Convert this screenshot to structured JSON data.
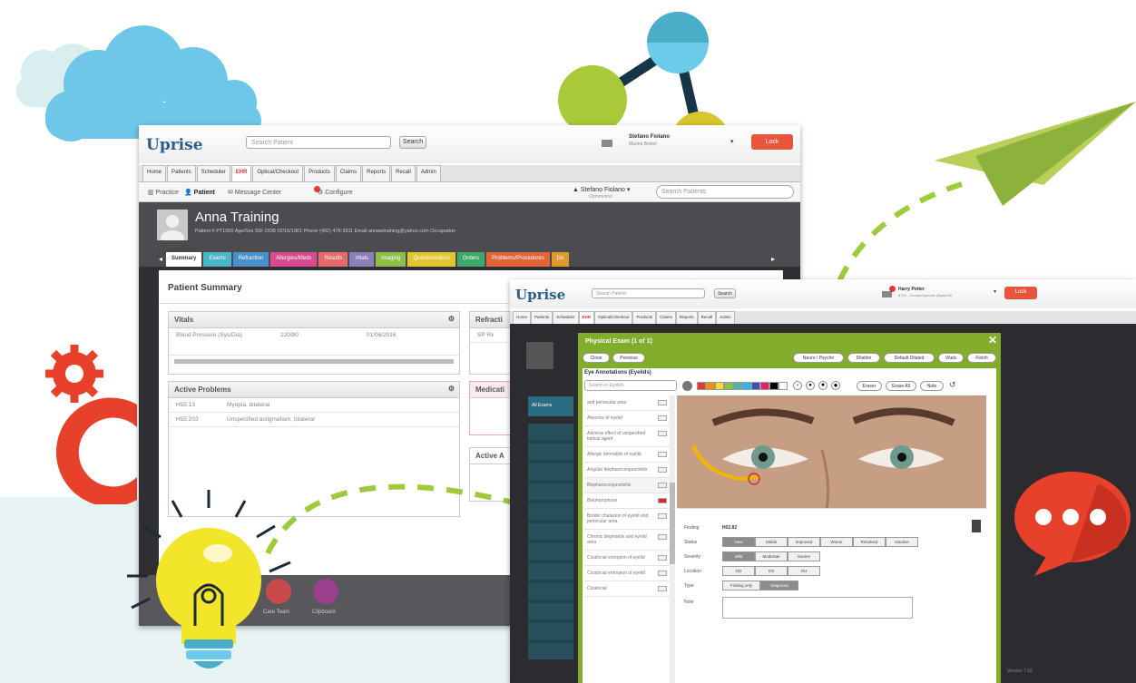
{
  "back_window": {
    "logo": "Uprise",
    "search_placeholder": "Search Patient",
    "search_button": "Search",
    "user_name": "Stefano Fiolano",
    "user_sub": "Marina Bristol",
    "lock_button": "Lock",
    "tabs": [
      {
        "label": "Home",
        "active": false
      },
      {
        "label": "Patients",
        "active": false
      },
      {
        "label": "Scheduler",
        "active": false
      },
      {
        "label": "EHR",
        "active": true
      },
      {
        "label": "Optical/Checkout",
        "active": false
      },
      {
        "label": "Products",
        "active": false
      },
      {
        "label": "Claims",
        "active": false
      },
      {
        "label": "Reports",
        "active": false
      },
      {
        "label": "Recall",
        "active": false
      },
      {
        "label": "Admin",
        "active": false
      }
    ],
    "subnav": {
      "practice": "Practice",
      "patient": "Patient",
      "message_center": "Message Center",
      "configure": "Configure",
      "user": "Stefano Fiolano",
      "user_role": "Optometrist",
      "search_placeholder": "Search Patients"
    },
    "patient": {
      "name": "Anna Training",
      "info": "Patient #  PT1000  Age/Sex  55F  DOB  02/15/1961  Phone  (402) 476-3311  Email  annawtraining@yahoo.com  Occupation"
    },
    "ehr_tabs": [
      {
        "label": "Summary",
        "color": "#ffffff"
      },
      {
        "label": "Exams",
        "color": "#49b7c7"
      },
      {
        "label": "Refraction",
        "color": "#4b8fc9"
      },
      {
        "label": "Allergies/Meds",
        "color": "#d84b8d"
      },
      {
        "label": "Results",
        "color": "#e56a6a"
      },
      {
        "label": "Vitals",
        "color": "#8a7fb8"
      },
      {
        "label": "Imaging",
        "color": "#8cc04a"
      },
      {
        "label": "Questionnaires",
        "color": "#e3c52d"
      },
      {
        "label": "Orders",
        "color": "#3fa76a"
      },
      {
        "label": "Problems/Procedures",
        "color": "#e2653a"
      },
      {
        "label": "Do",
        "color": "#e09a2c"
      }
    ],
    "summary_title": "Patient Summary",
    "vitals": {
      "title": "Vitals",
      "rows": [
        {
          "name": "Blood Pressure (Sys/Dia)",
          "value": "120/80",
          "date": "01/06/2016"
        }
      ]
    },
    "refraction_title": "Refracti",
    "refraction_row": "SP Rx",
    "active_problems": {
      "title": "Active Problems",
      "rows": [
        {
          "code": "H52.13",
          "desc": "Myopia, bilateral"
        },
        {
          "code": "H52.203",
          "desc": "Unspecified astigmatism, bilateral"
        }
      ]
    },
    "medications_title": "Medicati",
    "active_a_title": "Active A",
    "bottom_labels": [
      "Care Team",
      "Clipboard"
    ]
  },
  "front_window": {
    "logo": "Uprise",
    "search_placeholder": "Search Patient",
    "search_button": "Search",
    "user_name": "Harry Potter",
    "user_sub": "8700 - Central Eyecare Alpha256",
    "lock_button": "Lock",
    "tabs": [
      "Home",
      "Patients",
      "Scheduler",
      "EHR",
      "Optical/Checkout",
      "Products",
      "Claims",
      "Reports",
      "Recall",
      "Admin"
    ],
    "sidebar_items": [
      "All Exams"
    ],
    "footer_text": "Version 7.16"
  },
  "modal": {
    "title": "Physical Exam (1 of 1)",
    "close_label": "Close",
    "previous_label": "Previous",
    "right_buttons": [
      "Neuro / Psycho",
      "Dilation",
      "Default Dilated",
      "Vitals",
      "Finish"
    ],
    "section_title": "Eye Annotations (Eyelids)",
    "search_placeholder": "Search in Eyelids",
    "swatches": [
      "#e53935",
      "#fb8c00",
      "#fdd835",
      "#8bc34a",
      "#4db6ac",
      "#29b6f6",
      "#3f51b5",
      "#e91e63",
      "#000000",
      "#ffffff"
    ],
    "tool_buttons": [
      "Eraser",
      "Erase All",
      "Note"
    ],
    "list_items": [
      "and periocular area",
      "Abscess of eyelid",
      "Adverse effect of unspecified topical agent",
      "Allergic dermatitis of eyelid",
      "Angular blepharoconjunctivitis",
      "Blepharoconjunctivitis",
      "Blepharoptosis",
      "Broder chalazion of eyelid and periocular area",
      "Chronic blepharitis and eyelid area",
      "Cicatricial ectropion of eyelid",
      "Cicatricial entropion of eyelid",
      "Cicatricial"
    ],
    "finding_label": "Finding",
    "finding_value": "H02.82",
    "status_label": "Status",
    "status_options": [
      "New",
      "Stable",
      "Improved",
      "Worse",
      "Resolved",
      "Inactive"
    ],
    "status_selected": "New",
    "severity_label": "Severity",
    "severity_options": [
      "Mild",
      "Moderate",
      "Severe"
    ],
    "severity_selected": "Mild",
    "location_label": "Location",
    "location_options": [
      "OD",
      "OS",
      "OU"
    ],
    "type_label": "Type",
    "type_options": [
      "Finding only",
      "Diagnosis"
    ],
    "type_selected": "Diagnosis",
    "note_label": "Note"
  }
}
